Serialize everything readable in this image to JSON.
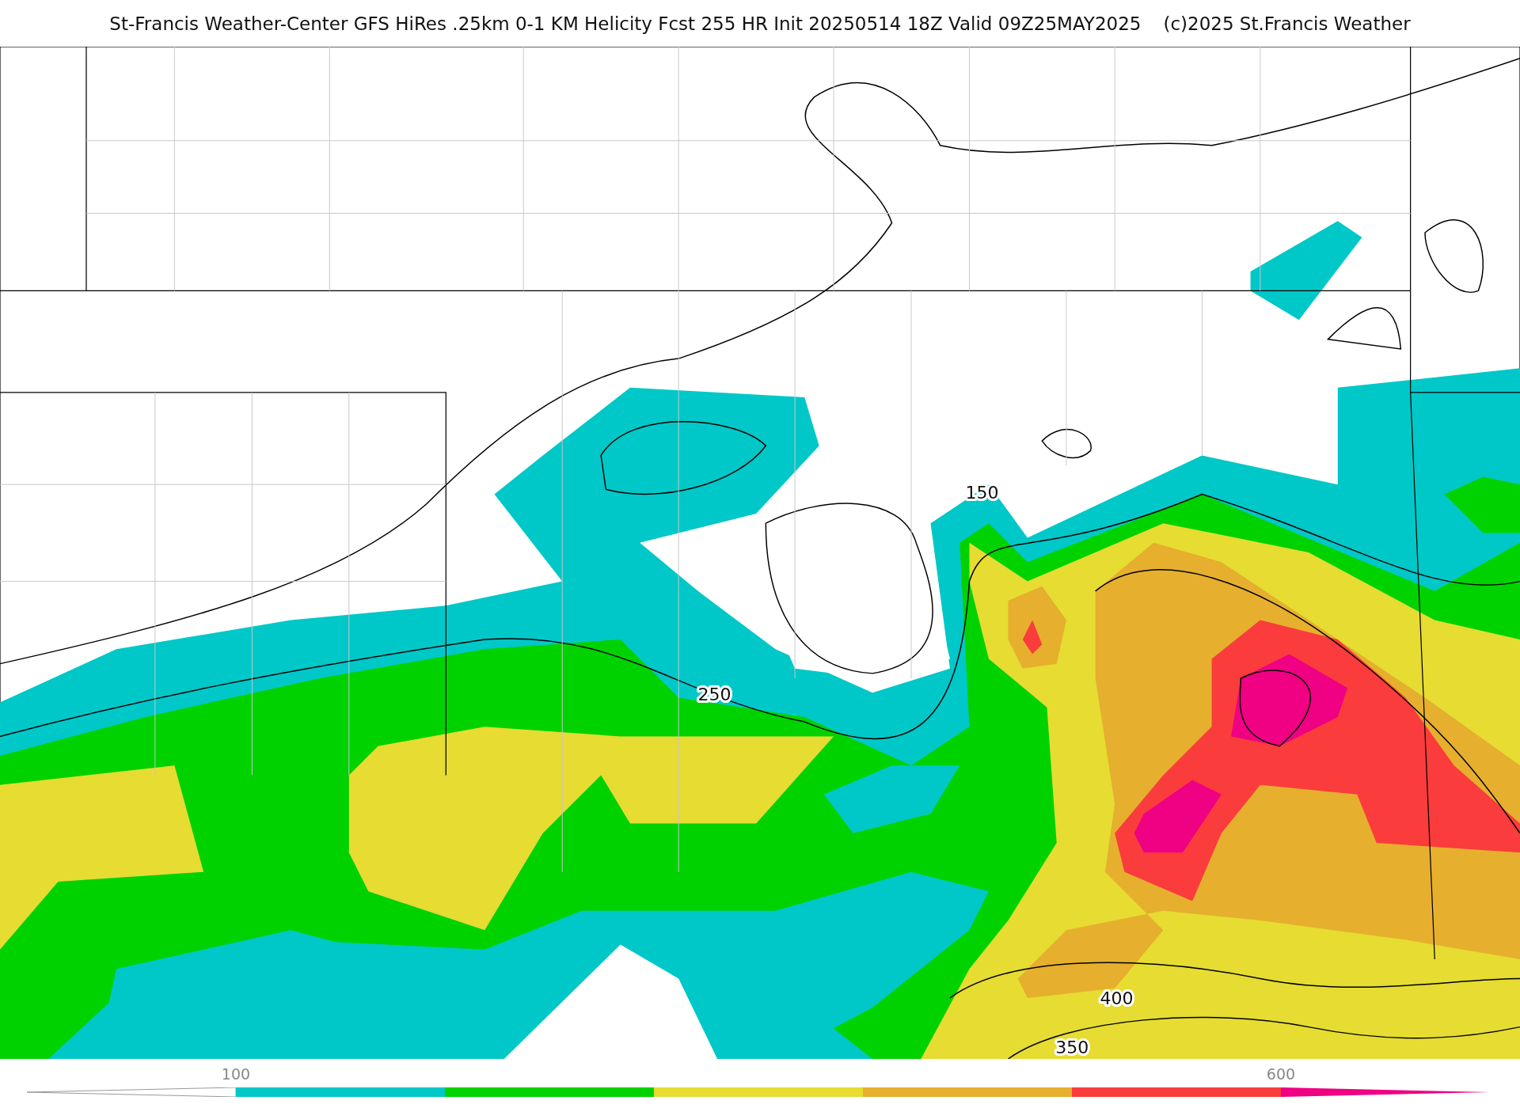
{
  "title": "St-Francis Weather-Center GFS HiRes .25km 0-1 KM Helicity Fcst 255 HR Init 20250514 18Z  Valid 09Z25MAY2025",
  "copyright": "(c)2025 St.Francis Weather",
  "contour_labels": [
    "150",
    "250",
    "400",
    "350"
  ],
  "colorbar": {
    "segments": [
      {
        "kind": "left-arrow"
      },
      {
        "kind": "band",
        "color": "#00c8c8"
      },
      {
        "kind": "band",
        "color": "#00d200"
      },
      {
        "kind": "band",
        "color": "#e6dc32"
      },
      {
        "kind": "band",
        "color": "#e6af2d"
      },
      {
        "kind": "band",
        "color": "#fa3c3c"
      },
      {
        "kind": "right-arrow",
        "color": "#f00082"
      }
    ],
    "ticks": [
      "100",
      "600"
    ]
  }
}
